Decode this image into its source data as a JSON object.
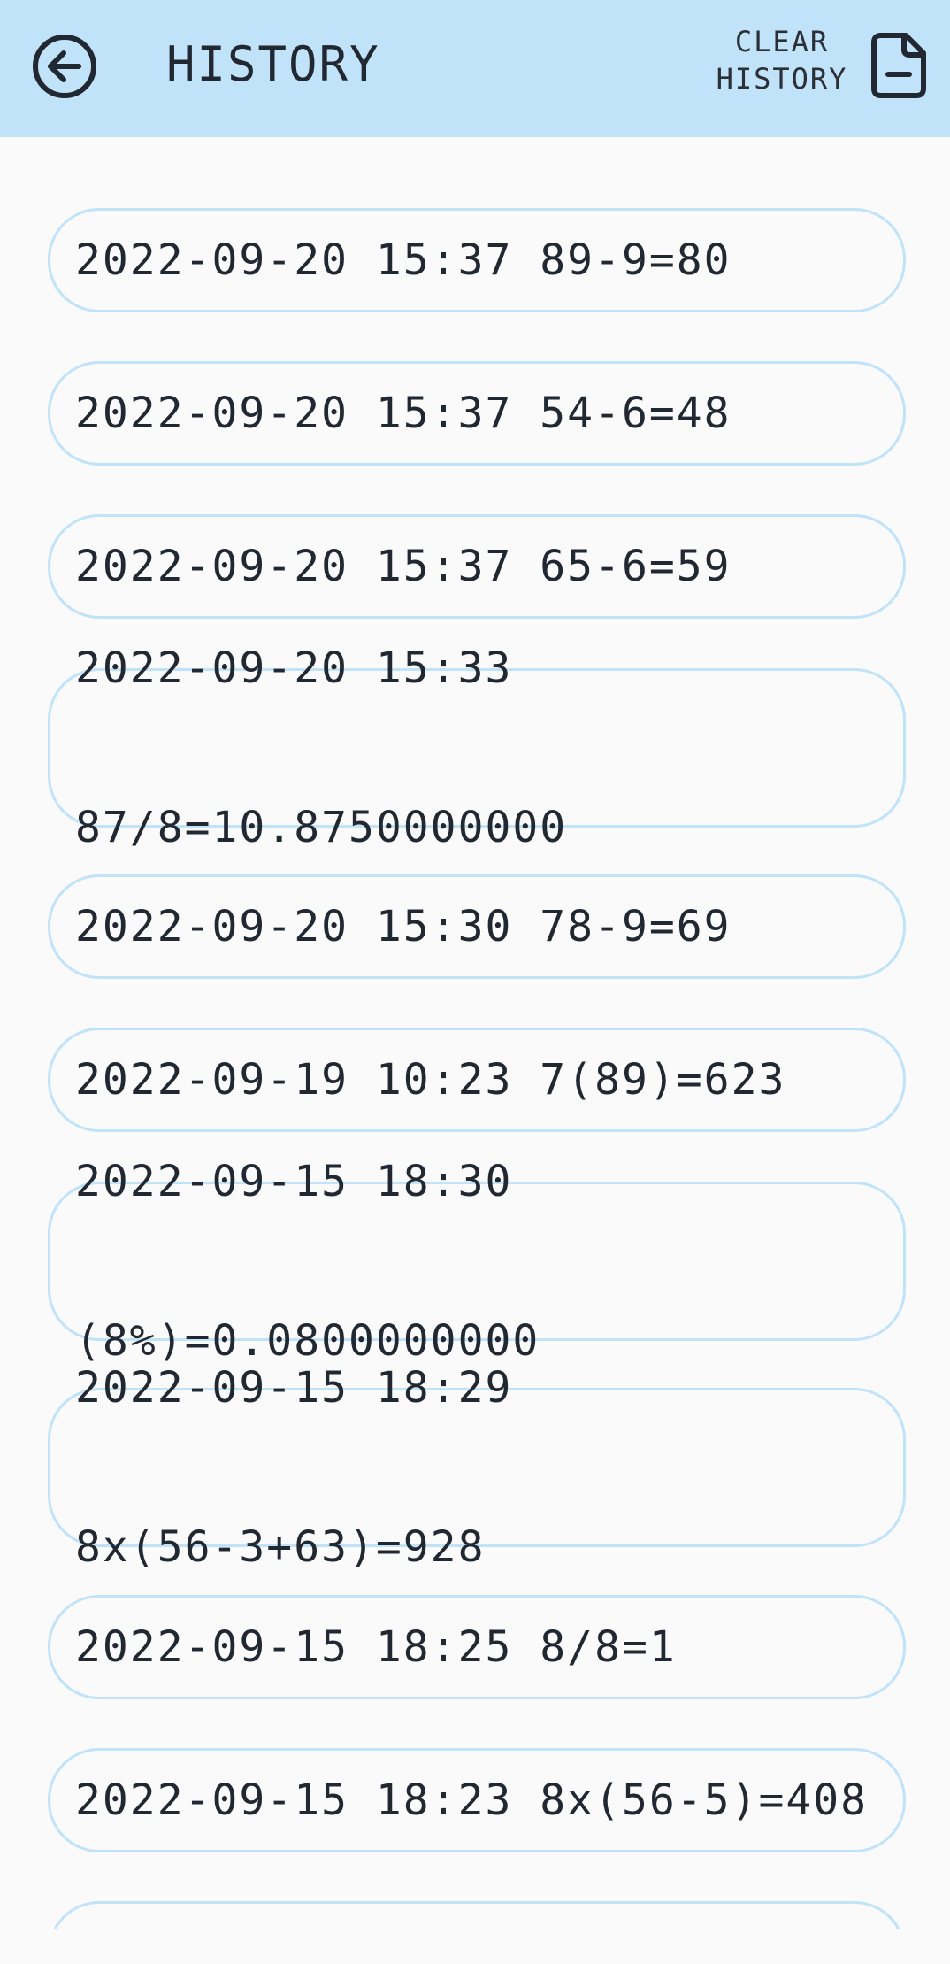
{
  "app_bar": {
    "title": "HISTORY",
    "clear_line1": "CLEAR",
    "clear_line2": "HISTORY",
    "back_icon": "arrow-left-circle-icon",
    "document_icon": "document-minus-icon",
    "background_color": "#c1e3fa"
  },
  "history": [
    {
      "line1": "2022-09-20 15:37 89-9=80",
      "line2": ""
    },
    {
      "line1": "2022-09-20 15:37 54-6=48",
      "line2": ""
    },
    {
      "line1": "2022-09-20 15:37 65-6=59",
      "line2": ""
    },
    {
      "line1": "2022-09-20 15:33",
      "line2": "87/8=10.8750000000"
    },
    {
      "line1": "2022-09-20 15:30 78-9=69",
      "line2": ""
    },
    {
      "line1": "2022-09-19 10:23 7(89)=623",
      "line2": ""
    },
    {
      "line1": "2022-09-15 18:30",
      "line2": "(8%)=0.0800000000"
    },
    {
      "line1": "2022-09-15 18:29",
      "line2": "8x(56-3+63)=928"
    },
    {
      "line1": "2022-09-15 18:25 8/8=1",
      "line2": ""
    },
    {
      "line1": "2022-09-15 18:23 8x(56-5)=408",
      "line2": ""
    }
  ],
  "colors": {
    "card_border": "#c1e3fa",
    "page_background": "#fafafa",
    "text": "#222831"
  }
}
